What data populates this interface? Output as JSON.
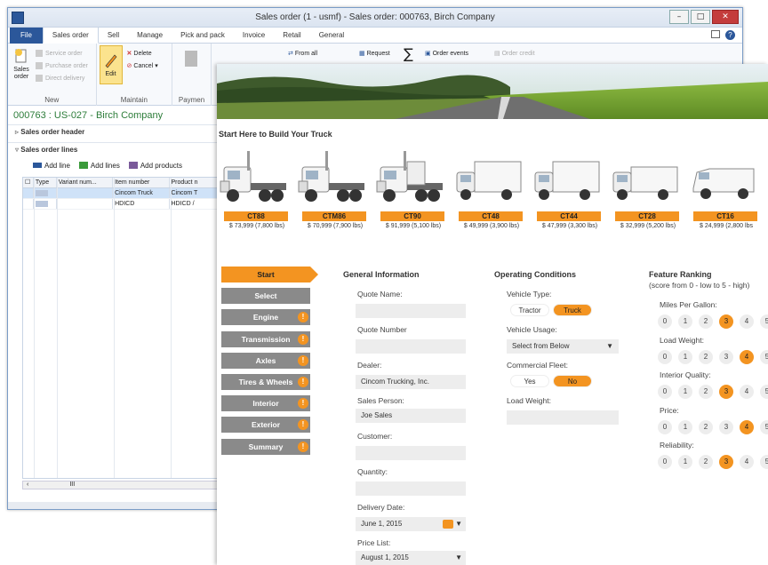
{
  "erp": {
    "window_title": "Sales order (1 - usmf) - Sales order: 000763, Birch Company",
    "ribbon_tabs": [
      "File",
      "Sales order",
      "Sell",
      "Manage",
      "Pick and pack",
      "Invoice",
      "Retail",
      "General"
    ],
    "ribbon": {
      "new_group_label": "New",
      "sales_order_label": "Sales order",
      "service_order_label": "Service order",
      "purchase_order_label": "Purchase order",
      "direct_delivery_label": "Direct delivery",
      "maintain_group_label": "Maintain",
      "edit_label": "Edit",
      "delete_label": "Delete",
      "cancel_label": "Cancel",
      "payment_group_label": "Paymen",
      "from_all_label": "From all",
      "request_label": "Request",
      "order_events_label": "Order events",
      "order_credit_label": "Order credit"
    },
    "record_title": "000763 : US-027 - Birch Company",
    "header_fasttab": "Sales order header",
    "lines_fasttab": "Sales order lines",
    "lines_toolbar": {
      "add_line": "Add line",
      "add_lines": "Add lines",
      "add_products": "Add products"
    },
    "grid_columns": [
      "Type",
      "Variant num...",
      "Item number",
      "Product n"
    ],
    "grid_rows": [
      {
        "item": "Cincom Truck",
        "product": "Cincom T"
      },
      {
        "item": "HDICD",
        "product": "HDICD / "
      }
    ],
    "scroll_glyph": "III"
  },
  "builder": {
    "build_title": "Start Here to Build Your Truck",
    "models": [
      {
        "name": "CT88",
        "price": "$ 73,999 (7,800 lbs)"
      },
      {
        "name": "CTM86",
        "price": "$ 70,999 (7,900 lbs)"
      },
      {
        "name": "CT90",
        "price": "$ 91,999 (5,100 lbs)"
      },
      {
        "name": "CT48",
        "price": "$ 49,999 (3,900 lbs)"
      },
      {
        "name": "CT44",
        "price": "$ 47,999 (3,300 lbs)"
      },
      {
        "name": "CT28",
        "price": "$ 32,999 (5,200 lbs)"
      },
      {
        "name": "CT16",
        "price": "$ 24,999 (2,800 lbs"
      }
    ],
    "nav": [
      "Start",
      "Select",
      "Engine",
      "Transmission",
      "Axles",
      "Tires & Wheels",
      "Interior",
      "Exterior",
      "Summary"
    ],
    "nav_badge": "!",
    "general": {
      "heading": "General Information",
      "quote_name_label": "Quote Name:",
      "quote_name_value": "",
      "quote_number_label": "Quote Number",
      "quote_number_value": "",
      "dealer_label": "Dealer:",
      "dealer_value": "Cincom Trucking, Inc.",
      "sales_person_label": "Sales Person:",
      "sales_person_value": "Joe Sales",
      "customer_label": "Customer:",
      "customer_value": "",
      "quantity_label": "Quantity:",
      "quantity_value": "",
      "delivery_date_label": "Delivery Date:",
      "delivery_date_value": "June 1, 2015",
      "price_list_label": "Price List:",
      "price_list_value": "August 1, 2015"
    },
    "operating": {
      "heading": "Operating Conditions",
      "vehicle_type_label": "Vehicle Type:",
      "vehicle_type_options": [
        "Tractor",
        "Truck"
      ],
      "vehicle_type_selected": "Truck",
      "vehicle_usage_label": "Vehicle Usage:",
      "vehicle_usage_value": "Select from Below",
      "commercial_fleet_label": "Commercial Fleet:",
      "commercial_fleet_options": [
        "Yes",
        "No"
      ],
      "commercial_fleet_selected": "No",
      "load_weight_label": "Load Weight:",
      "load_weight_value": ""
    },
    "ranking": {
      "heading": "Feature Ranking",
      "subheading": "(score from 0 - low to 5 - high)",
      "scale": [
        "0",
        "1",
        "2",
        "3",
        "4",
        "5"
      ],
      "items": [
        {
          "label": "Miles Per Gallon:",
          "value": 3
        },
        {
          "label": "Load Weight:",
          "value": 4
        },
        {
          "label": "Interior Quality:",
          "value": 3
        },
        {
          "label": "Price:",
          "value": 4
        },
        {
          "label": "Reliability:",
          "value": 3
        }
      ]
    },
    "colors": {
      "accent": "#f39421",
      "nav_inactive": "#8a8a8a",
      "erp_blue": "#2b579a"
    }
  }
}
